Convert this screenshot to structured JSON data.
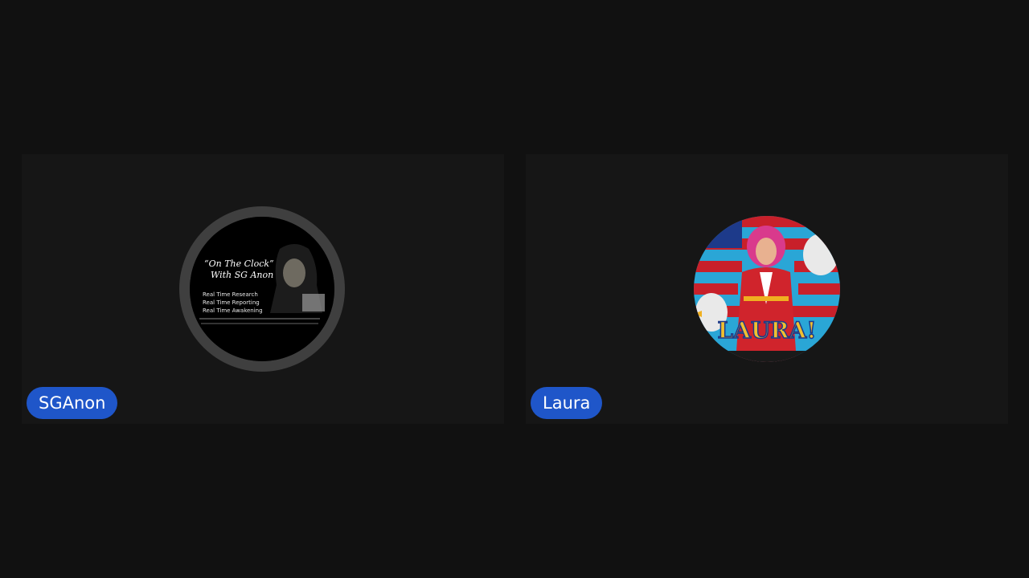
{
  "participants": [
    {
      "name": "SGAnon",
      "avatar": {
        "icon": "sganon-avatar-image",
        "title_line1": "“On The Clock”",
        "title_line2": "With SG Anon",
        "bullet1": "Real Time Research",
        "bullet2": "Real Time Reporting",
        "bullet3": "Real Time Awakening"
      }
    },
    {
      "name": "Laura",
      "avatar": {
        "icon": "laura-avatar-image",
        "banner_text": "LAURA!"
      }
    }
  ],
  "colors": {
    "background": "#111111",
    "tile": "#161616",
    "name_pill": "#1f56c9",
    "avatar_ring": "#3f3f3f"
  }
}
